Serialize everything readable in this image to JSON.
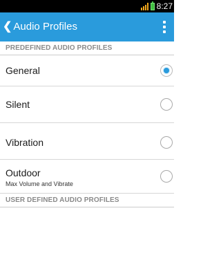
{
  "status_bar": {
    "time": "8:27",
    "signal_color": "#f2a81c",
    "battery_color": "#3fbf3f"
  },
  "app_bar": {
    "back_icon": "chevron-left-icon",
    "title": "Audio Profiles",
    "overflow_icon": "more-vert-icon",
    "color": "#2a9bdc"
  },
  "sections": {
    "predefined_header": "PREDEFINED AUDIO PROFILES",
    "user_defined_header": "USER DEFINED AUDIO PROFILES"
  },
  "profiles": [
    {
      "title": "General",
      "subtitle": "",
      "selected": true
    },
    {
      "title": "Silent",
      "subtitle": "",
      "selected": false
    },
    {
      "title": "Vibration",
      "subtitle": "",
      "selected": false
    },
    {
      "title": "Outdoor",
      "subtitle": "Max Volume and Vibrate",
      "selected": false
    }
  ]
}
